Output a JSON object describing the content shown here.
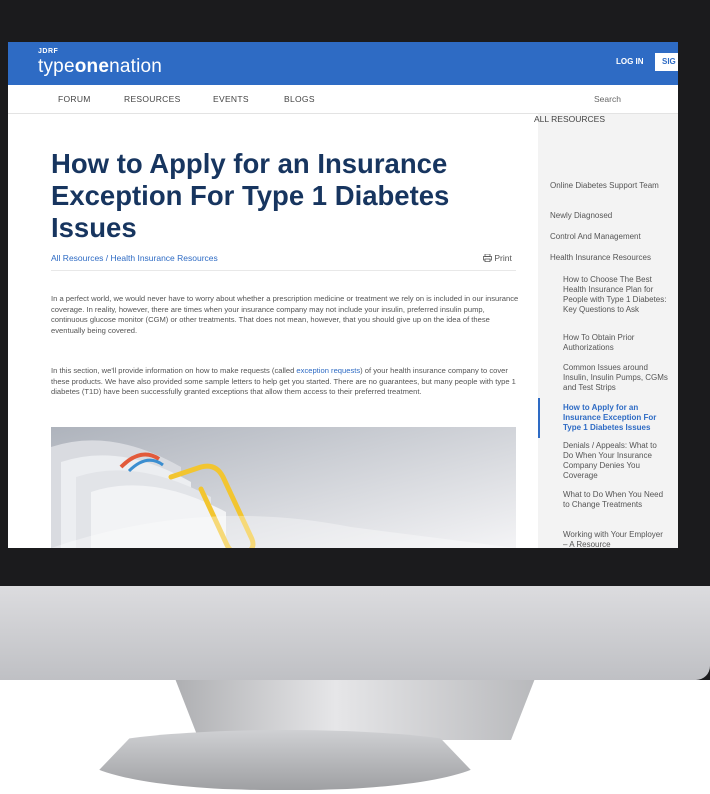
{
  "header": {
    "logo_top": "JDRF",
    "logo_word_a": "type",
    "logo_word_b": "one",
    "logo_word_c": "nation",
    "login_label": "LOG IN",
    "signup_label": "SIG"
  },
  "nav": {
    "items": [
      "FORUM",
      "RESOURCES",
      "EVENTS",
      "BLOGS"
    ],
    "search_placeholder": "Search"
  },
  "article": {
    "title": "How to Apply for an Insurance Exception For Type 1 Diabetes Issues",
    "breadcrumb": "All Resources / Health Insurance Resources",
    "print_label": "Print",
    "paragraph1": "In a perfect world, we would never have to worry about whether a prescription medicine or treatment we rely on is included in our insurance coverage. In reality, however, there are times when your insurance company may not include your insulin, preferred insulin pump, continuous glucose monitor (CGM) or other treatments. That does not mean, however, that you should give up on the idea of these eventually being covered.",
    "paragraph2_before": "In this section, we'll provide information on how to make requests (called ",
    "paragraph2_link": "exception requests",
    "paragraph2_after": ") of your health insurance company to cover these products. We have also provided some sample letters to help get you started. There are no guarantees, but many people with type 1 diabetes (T1D) have been successfully granted exceptions that allow them access to their preferred treatment."
  },
  "sidebar": {
    "heading": "ALL RESOURCES",
    "items": [
      "Online Diabetes Support Team",
      "Newly Diagnosed",
      "Control And Management",
      "Health Insurance Resources"
    ],
    "subitems": [
      "How to Choose The Best Health Insurance Plan for People with Type 1 Diabetes: Key Questions to Ask",
      "How To Obtain Prior Authorizations",
      "Common Issues around Insulin, Insulin Pumps, CGMs and Test Strips",
      "How to Apply for an Insurance Exception For Type 1 Diabetes Issues",
      "Denials / Appeals: What to Do When Your Insurance Company Denies You Coverage",
      "What to Do When You Need to Change Treatments",
      "Working with Your Employer – A Resource"
    ],
    "active_index": 3
  },
  "colors": {
    "brand_blue": "#2e6bc4",
    "title_navy": "#17355f"
  },
  "icons": {
    "print": "printer-icon"
  }
}
